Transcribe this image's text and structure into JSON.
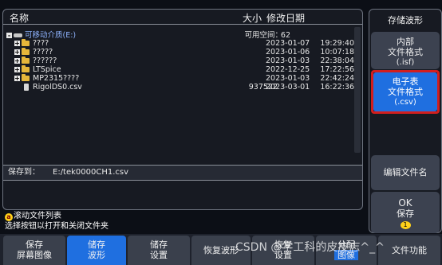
{
  "header": {
    "name_col": "名称",
    "size_col": "大小",
    "date_col": "修改日期"
  },
  "root": {
    "label": "可移动介质(E:)",
    "free_label": "可用空间：",
    "free_value": "62"
  },
  "files": [
    {
      "name": "????",
      "kind": "folder",
      "size": "",
      "date": "2023-01-07",
      "time": "19:29:40"
    },
    {
      "name": "?????",
      "kind": "folder",
      "size": "",
      "date": "2023-01-06",
      "time": "10:07:18"
    },
    {
      "name": "??????",
      "kind": "folder",
      "size": "",
      "date": "2023-01-03",
      "time": "22:38:04"
    },
    {
      "name": "LTSpice",
      "kind": "folder",
      "size": "",
      "date": "2022-12-25",
      "time": "17:22:56"
    },
    {
      "name": "MP2315????",
      "kind": "folder",
      "size": "",
      "date": "2023-01-03",
      "time": "22:42:24"
    },
    {
      "name": "RigolDS0.csv",
      "kind": "file",
      "size": "937522",
      "date": "2023-03-01",
      "time": "16:22:36"
    }
  ],
  "save_to": {
    "label": "保存到：",
    "path": "E:/tek0000CH1.csv"
  },
  "help": {
    "knob_glyph": "a",
    "line1": "滚动文件列表",
    "line2": "选择按钮以打开和关闭文件夹"
  },
  "side_menu": {
    "title": "存储波形",
    "btn_internal": {
      "line1": "内部",
      "line2": "文件格式",
      "line3": "(.isf)"
    },
    "btn_spreadsheet": {
      "line1": "电子表",
      "line2": "文件格式",
      "line3": "(.csv)"
    },
    "btn_edit_name": "编辑文件名",
    "btn_ok": {
      "line1": "OK",
      "line2": "保存",
      "badge": "1"
    }
  },
  "bottom_menu": [
    {
      "line1": "保存",
      "line2": "屏幕图像",
      "active": false
    },
    {
      "line1": "储存",
      "line2": "波形",
      "active": true
    },
    {
      "line1": "储存",
      "line2": "设置",
      "active": false
    },
    {
      "line1": "恢复波形",
      "line2": "",
      "active": false
    },
    {
      "line1": "恢复",
      "line2": "设置",
      "active": false
    },
    {
      "line1": "分配",
      "line2": "图像",
      "active": false
    },
    {
      "line1": "文件功能",
      "line2": "",
      "active": false
    }
  ],
  "watermark": "CSDN @学工科的皮皮志^_^",
  "colors": {
    "selected_button": "#1f6fe0",
    "highlight_frame": "#d21e1e",
    "root_text": "#8fb4ff"
  }
}
